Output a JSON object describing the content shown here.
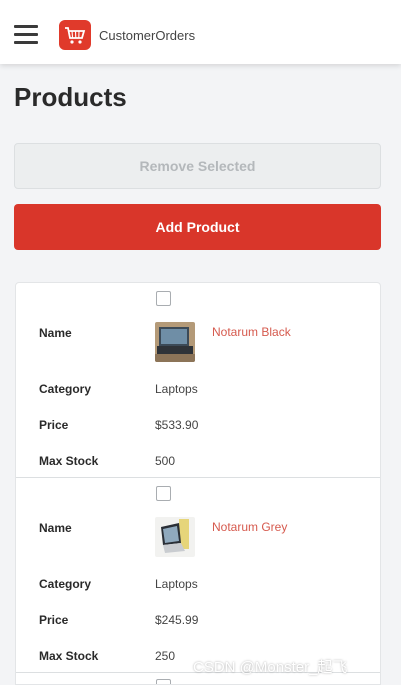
{
  "header": {
    "app_title": "CustomerOrders",
    "menu_icon": "hamburger-menu-icon",
    "logo_icon": "shopping-cart-icon"
  },
  "page": {
    "title": "Products",
    "remove_selected_label": "Remove Selected",
    "add_product_label": "Add Product"
  },
  "field_labels": {
    "name": "Name",
    "category": "Category",
    "price": "Price",
    "max_stock": "Max Stock"
  },
  "products": [
    {
      "name": "Notarum Black",
      "category": "Laptops",
      "price": "$533.90",
      "max_stock": "500"
    },
    {
      "name": "Notarum Grey",
      "category": "Laptops",
      "price": "$245.99",
      "max_stock": "250"
    }
  ],
  "watermark": "CSDN @Monster_起飞",
  "colors": {
    "accent": "#d9362a",
    "product_link": "#d65a4e",
    "disabled_text": "#b4b8bb"
  }
}
